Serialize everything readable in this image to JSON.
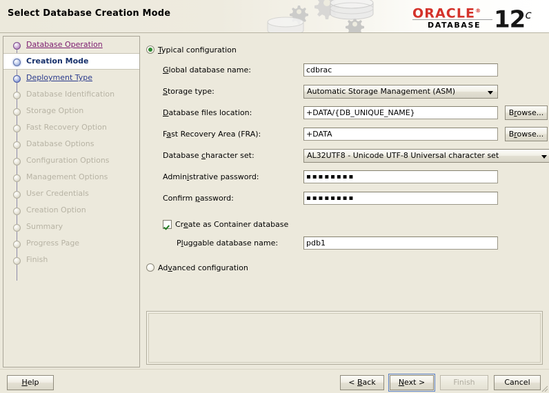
{
  "header": {
    "title": "Select Database Creation Mode",
    "logo_word": "ORACLE",
    "logo_reg": "®",
    "logo_sub": "DATABASE",
    "logo_version": "12",
    "logo_version_sup": "c"
  },
  "sidebar": {
    "steps": [
      {
        "label": "Database Operation",
        "state": "visited"
      },
      {
        "label": "Creation Mode",
        "state": "current"
      },
      {
        "label": "Deployment Type",
        "state": "link"
      },
      {
        "label": "Database Identification",
        "state": "disabled"
      },
      {
        "label": "Storage Option",
        "state": "disabled"
      },
      {
        "label": "Fast Recovery Option",
        "state": "disabled"
      },
      {
        "label": "Database Options",
        "state": "disabled"
      },
      {
        "label": "Configuration Options",
        "state": "disabled"
      },
      {
        "label": "Management Options",
        "state": "disabled"
      },
      {
        "label": "User Credentials",
        "state": "disabled"
      },
      {
        "label": "Creation Option",
        "state": "disabled"
      },
      {
        "label": "Summary",
        "state": "disabled"
      },
      {
        "label": "Progress Page",
        "state": "disabled"
      },
      {
        "label": "Finish",
        "state": "disabled"
      }
    ]
  },
  "main": {
    "typical_radio_label": "Typical configuration",
    "typical_radio_selected": true,
    "advanced_radio_label": "Advanced configuration",
    "advanced_radio_selected": false,
    "fields": {
      "global_db_name_label": "Global database name:",
      "global_db_name_value": "cdbrac",
      "storage_type_label": "Storage type:",
      "storage_type_value": "Automatic Storage Management (ASM)",
      "db_files_location_label": "Database files location:",
      "db_files_location_value": "+DATA/{DB_UNIQUE_NAME}",
      "fra_label": "Fast Recovery Area (FRA):",
      "fra_value": "+DATA",
      "charset_label": "Database character set:",
      "charset_value": "AL32UTF8 - Unicode UTF-8 Universal character set",
      "admin_password_label": "Administrative password:",
      "admin_password_value": "▪▪▪▪▪▪▪▪",
      "confirm_password_label": "Confirm password:",
      "confirm_password_value": "▪▪▪▪▪▪▪▪",
      "browse_label": "Browse...",
      "container_db_label": "Create as Container database",
      "container_db_checked": true,
      "pdb_name_label": "Pluggable database name:",
      "pdb_name_value": "pdb1"
    },
    "message_panel_text": ""
  },
  "footer": {
    "help": "Help",
    "back": "< Back",
    "next": "Next >",
    "finish": "Finish",
    "cancel": "Cancel"
  }
}
